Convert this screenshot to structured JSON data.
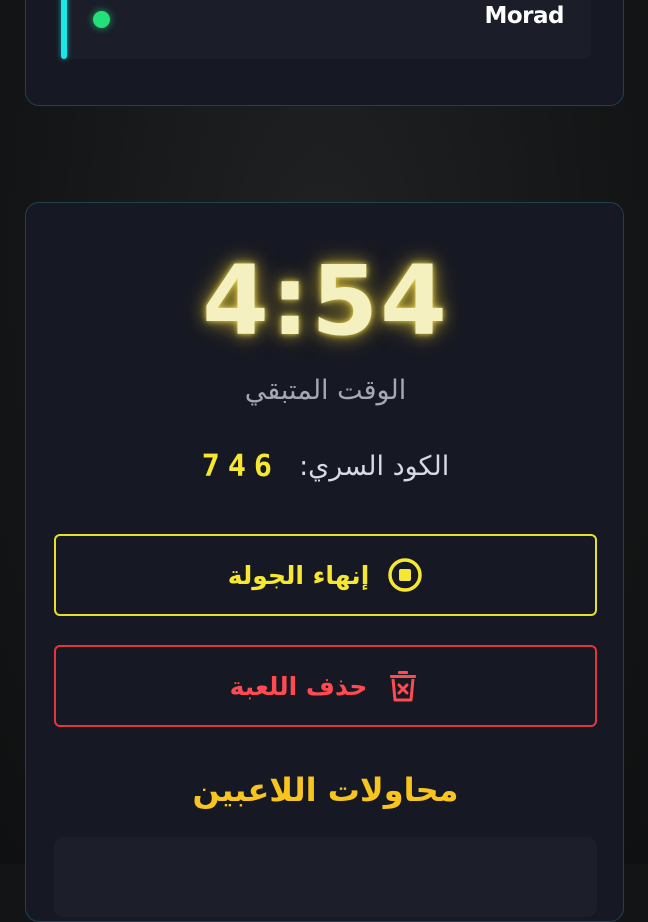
{
  "players": [
    {
      "name": "Morad",
      "status_color": "#22e07a"
    }
  ],
  "game": {
    "timer": "4:54",
    "time_label": "الوقت المتبقي",
    "code_label": "الكود السري:",
    "code_value": "746",
    "end_round_label": "إنهاء الجولة",
    "delete_game_label": "حذف اللعبة",
    "attempts_title": "محاولات اللاعبين"
  },
  "colors": {
    "accent_cyan": "#19e6e6",
    "online_green": "#22e07a",
    "timer_yellow": "#f4f0c0",
    "end_yellow": "#f6e830",
    "delete_red": "#e2353f",
    "title_gold": "#f7c51e"
  },
  "icons": {
    "end_round": "stop-circle-icon",
    "delete_game": "trash-icon"
  }
}
